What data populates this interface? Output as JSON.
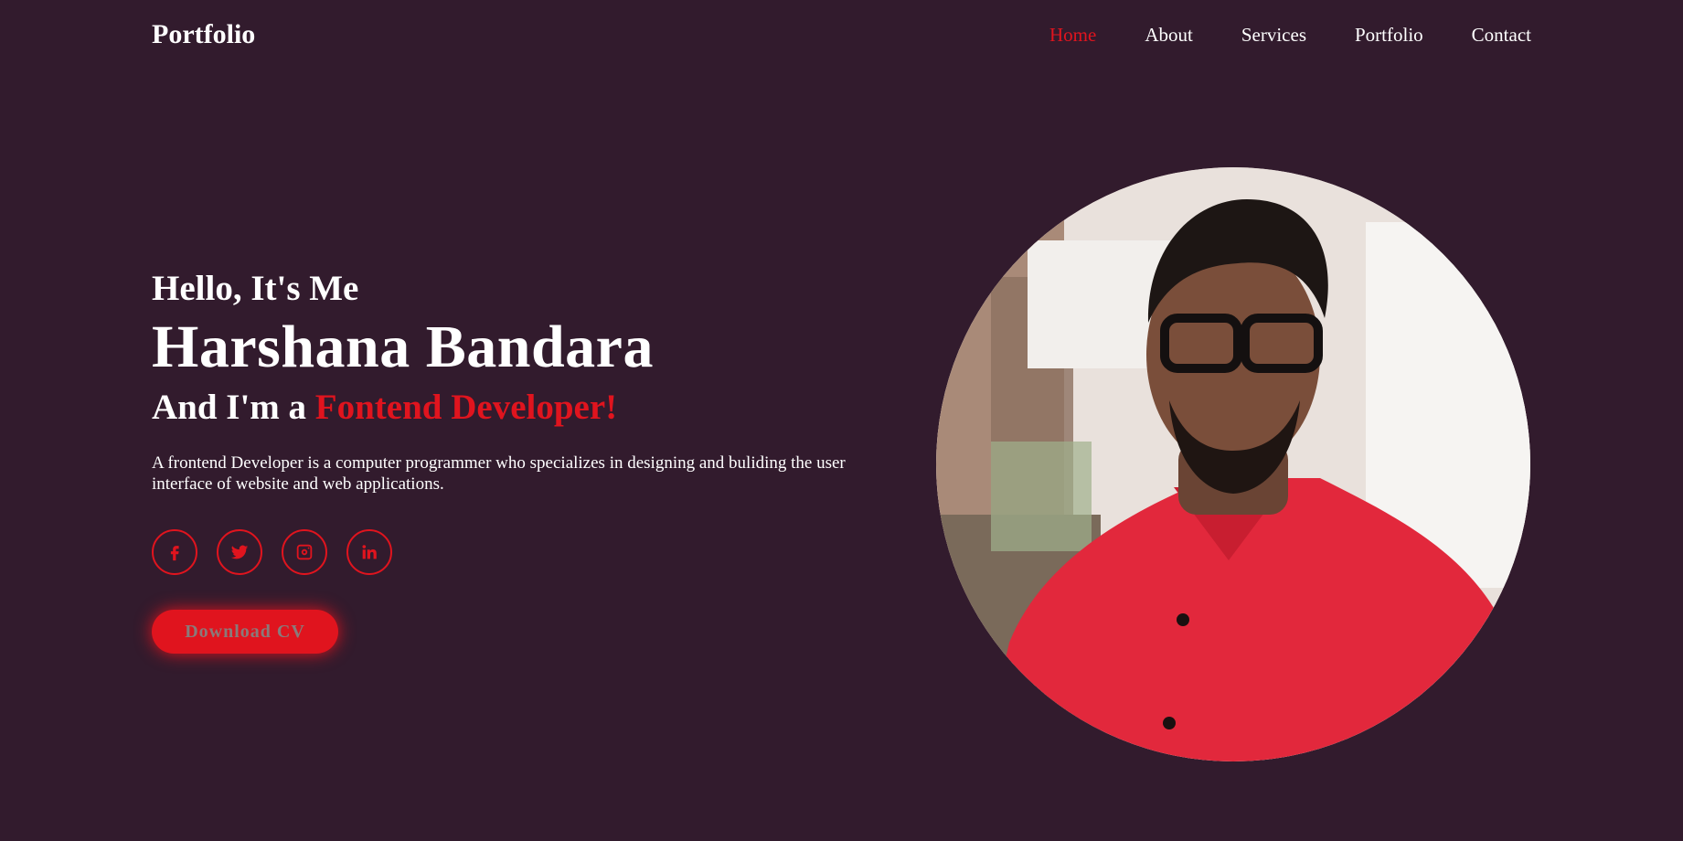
{
  "header": {
    "logo": "Portfolio",
    "nav": [
      {
        "label": "Home",
        "active": true
      },
      {
        "label": "About",
        "active": false
      },
      {
        "label": "Services",
        "active": false
      },
      {
        "label": "Portfolio",
        "active": false
      },
      {
        "label": "Contact",
        "active": false
      }
    ]
  },
  "hero": {
    "greeting": "Hello, It's Me",
    "name": "Harshana Bandara",
    "role_prefix": "And I'm a ",
    "role_highlight": "Fontend Developer!",
    "description": "A frontend Developer is a computer programmer who specializes in designing and buliding the user interface of website and web applications.",
    "socials": [
      {
        "icon": "facebook-icon"
      },
      {
        "icon": "twitter-icon"
      },
      {
        "icon": "instagram-icon"
      },
      {
        "icon": "linkedin-icon"
      }
    ],
    "cv_button": "Download CV"
  },
  "colors": {
    "background": "#321b2d",
    "accent": "#e0141e",
    "text": "#ffffff"
  }
}
